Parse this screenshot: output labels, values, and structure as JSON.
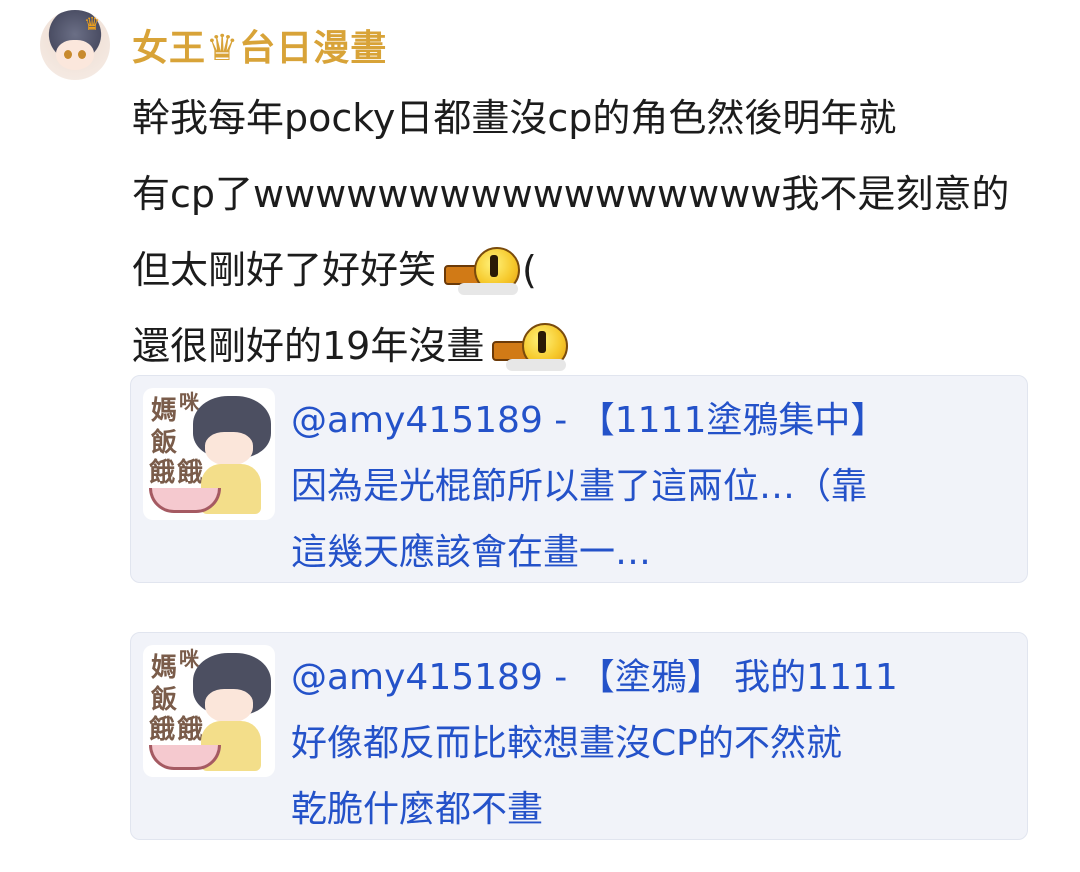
{
  "post": {
    "username": "女王♛台日漫畫",
    "lines": [
      "幹我每年pocky日都畫沒cp的角色然後明年就",
      "有cp了wwwwwwwwwwwwwwwww我不是刻意的",
      "但太剛好了好好笑",
      "還很剛好的19年沒畫"
    ],
    "line3_suffix": "("
  },
  "quotes": [
    {
      "lines": [
        "@amy415189 - 【1111塗鴉集中】",
        "因為是光棍節所以畫了這兩位…（靠",
        "這幾天應該會在畫一…"
      ],
      "thumb_text": [
        "媽",
        "咪",
        "飯",
        "餓",
        "餓"
      ]
    },
    {
      "lines": [
        "@amy415189 - 【塗鴉】 我的1111",
        "好像都反而比較想畫沒CP的不然就",
        "乾脆什麼都不畫"
      ],
      "thumb_text": [
        "媽",
        "咪",
        "飯",
        "餓",
        "餓"
      ]
    }
  ],
  "colors": {
    "username": "#d8a338",
    "quote_link": "#2452c9",
    "quote_bg": "#f1f3f9"
  },
  "icons": {
    "crown": "crown-icon",
    "emoji": "sweat-drop-emoji-icon"
  }
}
